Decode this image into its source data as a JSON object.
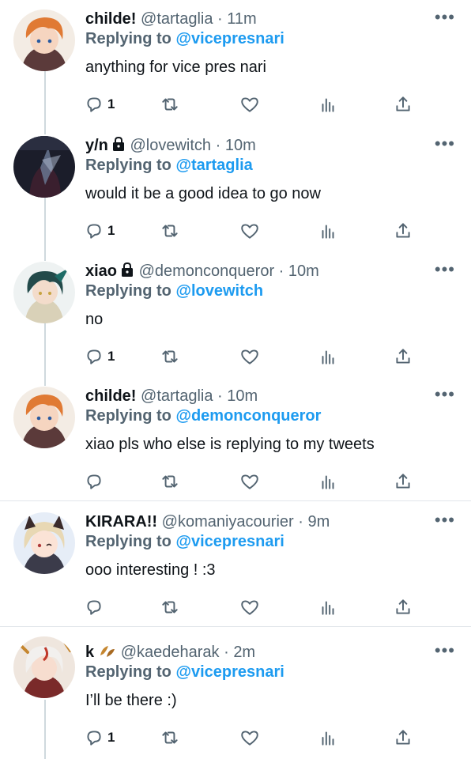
{
  "tweets": [
    {
      "name": "childe!",
      "handle": "@tartaglia",
      "dot": "·",
      "time": "11m",
      "replying_label": "Replying to",
      "mention": "@vicepresnari",
      "text": "anything for vice pres nari",
      "reply_count": "1",
      "locked": false,
      "avatar": "orange-hair"
    },
    {
      "name": "y/n",
      "handle": "@lovewitch",
      "dot": "·",
      "time": "10m",
      "replying_label": "Replying to",
      "mention": "@tartaglia",
      "text": "would it be a good idea to go now",
      "reply_count": "1",
      "locked": true,
      "avatar": "dark"
    },
    {
      "name": "xiao",
      "handle": "@demonconqueror",
      "dot": "·",
      "time": "10m",
      "replying_label": "Replying to",
      "mention": "@lovewitch",
      "text": "no",
      "reply_count": "1",
      "locked": true,
      "avatar": "teal-hair"
    },
    {
      "name": "childe!",
      "handle": "@tartaglia",
      "dot": "·",
      "time": "10m",
      "replying_label": "Replying to",
      "mention": "@demonconqueror",
      "text": "xiao pls who else is replying to my tweets",
      "reply_count": "",
      "locked": false,
      "avatar": "orange-hair"
    },
    {
      "name": "KIRARA!!",
      "handle": "@komaniyacourier",
      "dot": "·",
      "time": "9m",
      "replying_label": "Replying to",
      "mention": "@vicepresnari",
      "text": "ooo interesting ! :3",
      "reply_count": "",
      "locked": false,
      "avatar": "blonde-catgirl"
    },
    {
      "name": "k",
      "handle": "@kaedeharak",
      "dot": "·",
      "time": "2m",
      "replying_label": "Replying to",
      "mention": "@vicepresnari",
      "text": "I’ll be there :)",
      "reply_count": "1",
      "locked": false,
      "avatar": "white-hair",
      "badge": "maple-leaf-icon"
    }
  ],
  "more_label": "•••",
  "colors": {
    "accent": "#1d9bf0",
    "secondary": "#536471",
    "primary": "#0f1419",
    "divider": "#e1e6ea"
  }
}
